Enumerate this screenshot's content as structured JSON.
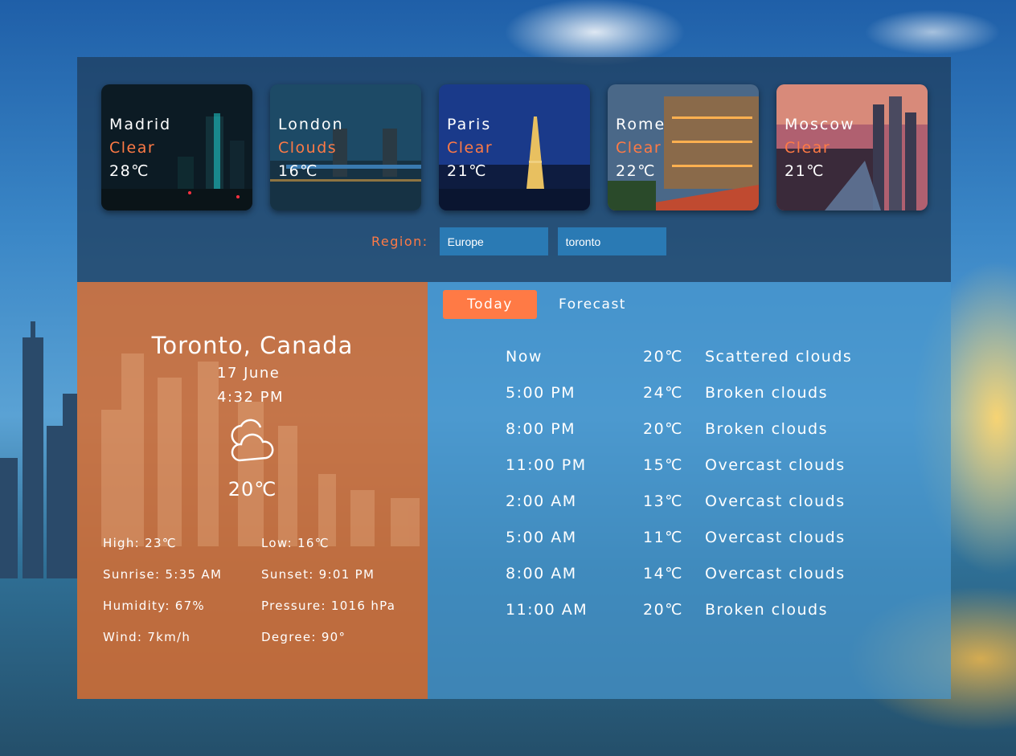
{
  "cities": [
    {
      "name": "Madrid",
      "condition": "Clear",
      "temp": "28℃"
    },
    {
      "name": "London",
      "condition": "Clouds",
      "temp": "16℃"
    },
    {
      "name": "Paris",
      "condition": "Clear",
      "temp": "21℃"
    },
    {
      "name": "Rome",
      "condition": "Clear",
      "temp": "22℃"
    },
    {
      "name": "Moscow",
      "condition": "Clear",
      "temp": "21℃"
    }
  ],
  "region": {
    "label": "Region:",
    "region_value": "Europe",
    "city_value": "toronto"
  },
  "current": {
    "place": "Toronto, Canada",
    "date": "17 June",
    "time": "4:32 PM",
    "icon": "cloud-icon",
    "temp": "20℃",
    "details": [
      "High: 23℃",
      "Low: 16℃",
      "Sunrise: 5:35 AM",
      "Sunset: 9:01 PM",
      "Humidity: 67%",
      "Pressure: 1016 hPa",
      "Wind: 7km/h",
      "Degree: 90°"
    ]
  },
  "tabs": {
    "today": "Today",
    "forecast": "Forecast"
  },
  "hourly": [
    {
      "time": "Now",
      "temp": "20℃",
      "desc": "Scattered clouds"
    },
    {
      "time": "5:00 PM",
      "temp": "24℃",
      "desc": "Broken clouds"
    },
    {
      "time": "8:00 PM",
      "temp": "20℃",
      "desc": "Broken clouds"
    },
    {
      "time": "11:00 PM",
      "temp": "15℃",
      "desc": "Overcast clouds"
    },
    {
      "time": "2:00 AM",
      "temp": "13℃",
      "desc": "Overcast clouds"
    },
    {
      "time": "5:00 AM",
      "temp": "11℃",
      "desc": "Overcast clouds"
    },
    {
      "time": "8:00 AM",
      "temp": "14℃",
      "desc": "Overcast clouds"
    },
    {
      "time": "11:00 AM",
      "temp": "20℃",
      "desc": "Broken clouds"
    }
  ],
  "colors": {
    "accent": "#ff7a45",
    "input_bg": "#2a7ab4",
    "left_panel": "#d66e32",
    "right_panel": "#4696cd"
  }
}
